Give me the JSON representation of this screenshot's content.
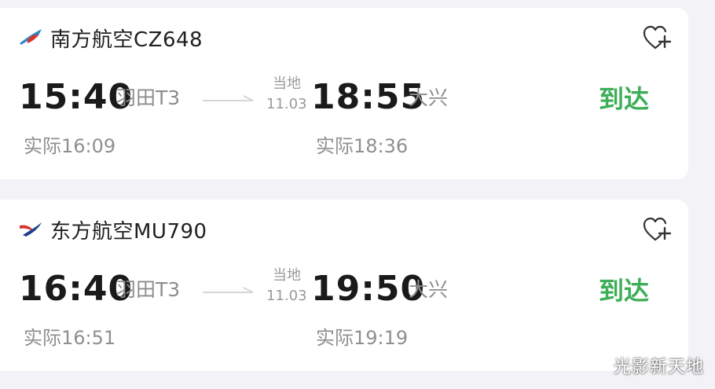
{
  "flights": [
    {
      "airline": "南方航空CZ648",
      "logo_icon": "china-southern-logo-icon",
      "dep_time": "15:40",
      "dep_airport": "羽田T3",
      "local_tag": "当地",
      "date": "11.03",
      "arr_time": "18:55",
      "arr_airport": "大兴",
      "status": "到达",
      "actual_dep": "实际16:09",
      "actual_arr": "实际18:36"
    },
    {
      "airline": "东方航空MU790",
      "logo_icon": "china-eastern-logo-icon",
      "dep_time": "16:40",
      "dep_airport": "羽田T3",
      "local_tag": "当地",
      "date": "11.03",
      "arr_time": "19:50",
      "arr_airport": "大兴",
      "status": "到达",
      "actual_dep": "实际16:51",
      "actual_arr": "实际19:19"
    }
  ],
  "favorite_icon": "heart-plus-icon",
  "status_color": "#3dae57",
  "watermark": "光影新天地"
}
